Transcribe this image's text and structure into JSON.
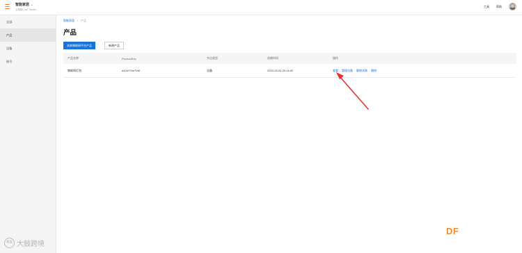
{
  "header": {
    "app_title": "智能家居",
    "app_subtitle": "公测版 | IoT Studio",
    "tools_label": "工具",
    "help_label": "帮助"
  },
  "sidebar": {
    "items": [
      {
        "label": "全部",
        "active": false
      },
      {
        "label": "产品",
        "active": true
      },
      {
        "label": "设备",
        "active": false
      },
      {
        "label": "账号",
        "active": false
      }
    ]
  },
  "breadcrumb": {
    "root": "智能家居",
    "separator": "/",
    "current": "产品"
  },
  "page": {
    "title": "产品",
    "primary_button": "关联物联网平台产品",
    "secondary_button": "新建产品"
  },
  "table": {
    "columns": [
      "产品名称",
      "ProductKey",
      "节点类型",
      "创建时间",
      "操作"
    ],
    "rows": [
      {
        "name": "物联网灯泡",
        "product_key": "a1GeTXInTvM",
        "node_type": "设备",
        "created": "2020-03-01 20:14:02",
        "actions": [
          "查看",
          "管理设备",
          "解除关联",
          "删除"
        ]
      }
    ]
  },
  "annotation": {
    "arrow_color": "#e8312b"
  },
  "branding": {
    "df_logo": "DF",
    "watermark_text": "大鼓跨境",
    "watermark_icon": "KS"
  },
  "colors": {
    "accent": "#1673d9",
    "link": "#1a6fd3",
    "menu_icon": "#f07b26",
    "df_logo": "#f08a2b"
  }
}
